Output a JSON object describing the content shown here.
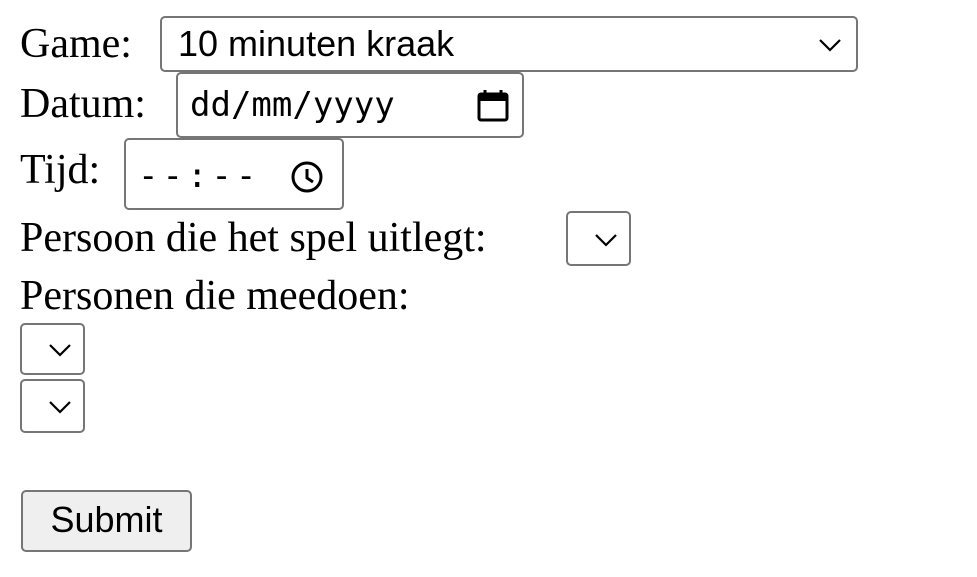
{
  "form": {
    "game": {
      "label": "Game:",
      "selected": "10 minuten kraak"
    },
    "datum": {
      "label": "Datum:",
      "placeholder": "dd/mm/yyyy"
    },
    "tijd": {
      "label": "Tijd:",
      "placeholder": "--:--"
    },
    "uitleg": {
      "label": "Persoon die het spel uitlegt:",
      "selected": ""
    },
    "deelnemers": {
      "label": "Personen die meedoen:",
      "selects": [
        {
          "selected": ""
        },
        {
          "selected": ""
        }
      ]
    },
    "submit_label": "Submit"
  },
  "icons": {
    "dropdown": "chevron-down-icon",
    "date": "calendar-icon",
    "time": "clock-icon"
  },
  "colors": {
    "border": "#767676",
    "button_bg": "#efefef",
    "text": "#000000"
  }
}
